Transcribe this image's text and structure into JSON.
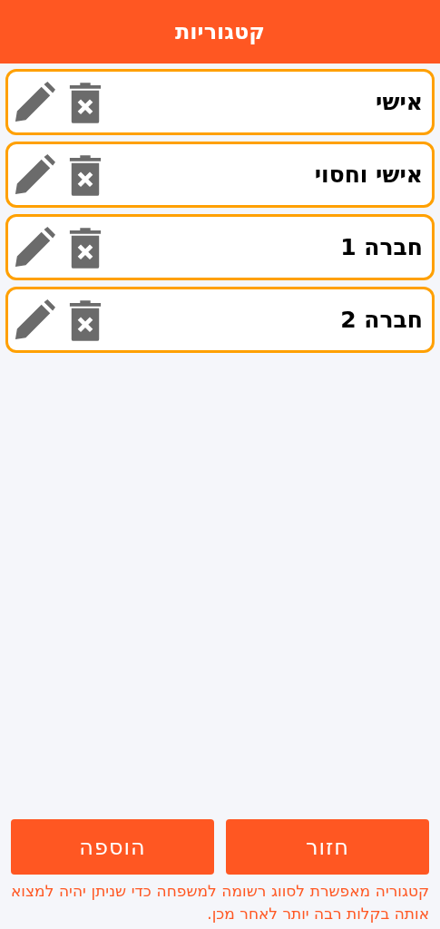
{
  "header": {
    "title": "קטגוריות"
  },
  "categories": [
    {
      "name": "אישי"
    },
    {
      "name": "אישי וחסוי"
    },
    {
      "name": "חברה 1"
    },
    {
      "name": "חברה 2"
    }
  ],
  "buttons": [
    {
      "label": "חזור"
    },
    {
      "label": "הוספה"
    }
  ],
  "note": "קטגוריה מאפשרת לסווג רשומה למשפחה כדי שניתן יהיה למצוא אותה בקלות רבה יותר לאחר מכן."
}
